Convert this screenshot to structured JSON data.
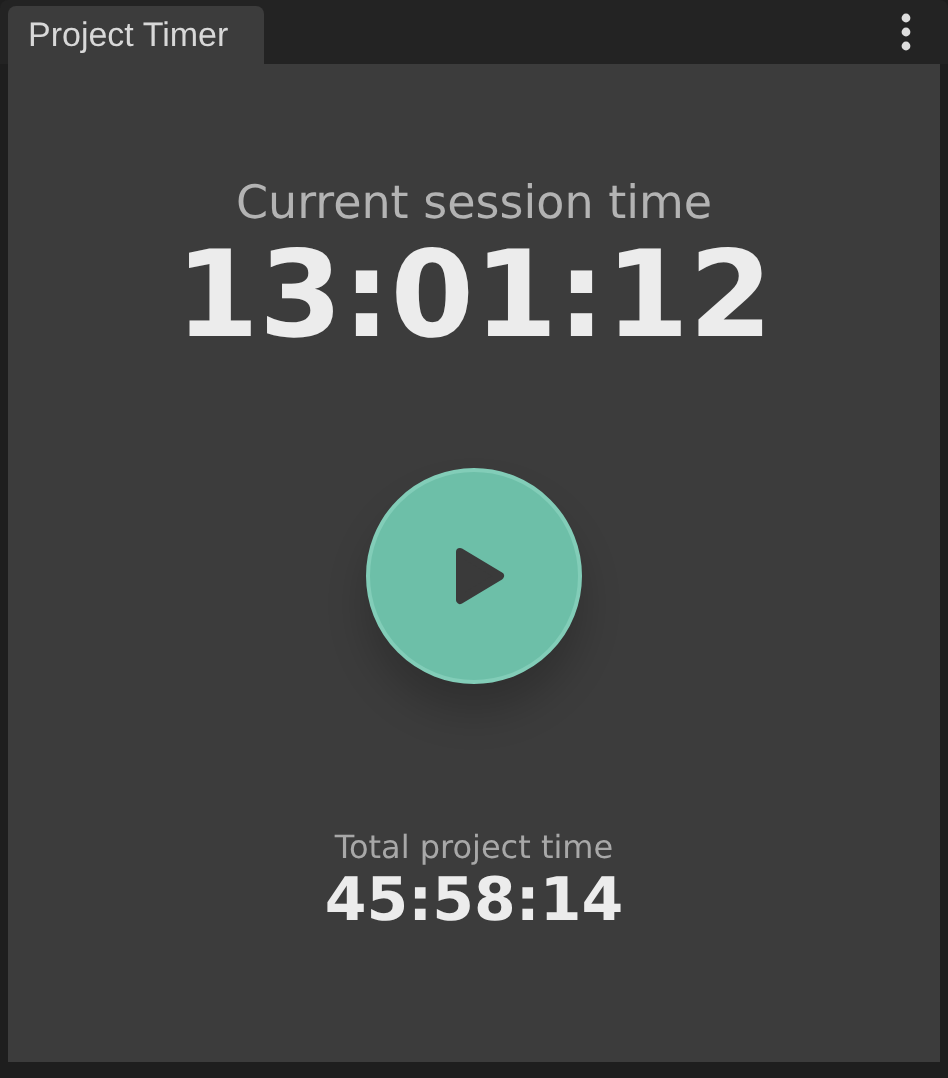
{
  "window": {
    "title": "Project Timer"
  },
  "session": {
    "label": "Current session time",
    "time": "13:01:12"
  },
  "total": {
    "label": "Total project time",
    "time": "45:58:14"
  }
}
